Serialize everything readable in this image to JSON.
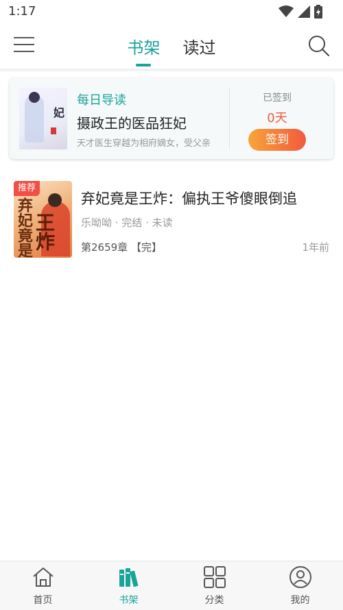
{
  "status_bar": {
    "time": "1:17"
  },
  "header": {
    "tabs": [
      {
        "label": "书架",
        "active": true
      },
      {
        "label": "读过",
        "active": false
      }
    ]
  },
  "daily_card": {
    "label": "每日导读",
    "title": "摄政王的医品狂妃",
    "description": "天才医生穿越为相府嫡女，受父亲",
    "signed_label": "已签到",
    "signed_days": "0天",
    "signin_button": "签到",
    "cover_text": "医品狂妃"
  },
  "books": [
    {
      "badge": "推荐",
      "title": "弃妃竟是王炸：偏执王爷傻眼倒追",
      "meta": "乐呦呦 · 完结 · 未读",
      "chapter": "第2659章 【完】",
      "updated": "1年前",
      "cover_text_1": "弃妃竟是",
      "cover_text_2": "王炸"
    }
  ],
  "bottom_nav": [
    {
      "label": "首页",
      "icon": "home-icon",
      "active": false
    },
    {
      "label": "书架",
      "icon": "bookshelf-icon",
      "active": true
    },
    {
      "label": "分类",
      "icon": "category-grid-icon",
      "active": false
    },
    {
      "label": "我的",
      "icon": "profile-icon",
      "active": false
    }
  ],
  "colors": {
    "accent": "#1aa39a",
    "sign_gradient_start": "#f7a43a",
    "sign_gradient_end": "#f25a3d",
    "badge_red": "#f04f45"
  }
}
